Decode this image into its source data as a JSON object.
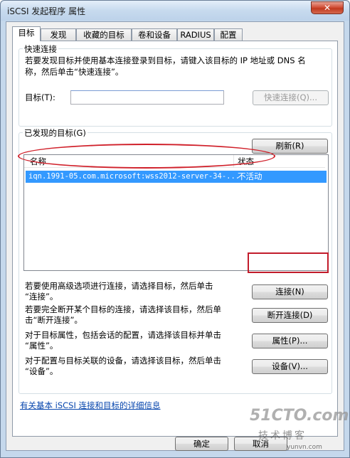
{
  "window": {
    "title": "iSCSI 发起程序 属性",
    "close_glyph": "✕"
  },
  "tabs": [
    {
      "label": "目标",
      "active": true
    },
    {
      "label": "发现"
    },
    {
      "label": "收藏的目标"
    },
    {
      "label": "卷和设备"
    },
    {
      "label": "RADIUS"
    },
    {
      "label": "配置"
    }
  ],
  "quick_connect": {
    "group_title": "快速连接",
    "description_line1": "若要发现目标并使用基本连接登录到目标，请键入该目标的 IP 地址或 DNS 名",
    "description_line2": "称，然后单击“快速连接”。",
    "target_label": "目标(T):",
    "target_value": "",
    "button_label": "快速连接(Q)..."
  },
  "discovered": {
    "group_title": "已发现的目标(G)",
    "refresh_label": "刷新(R)",
    "columns": [
      "名称",
      "状态"
    ],
    "rows": [
      {
        "name": "iqn.1991-05.com.microsoft:wss2012-server-34-...",
        "status": "不活动",
        "selected": true
      }
    ]
  },
  "actions": [
    {
      "line1": "若要使用高级选项进行连接，请选择目标，然后单击",
      "line2": "“连接”。",
      "button": "连接(N)"
    },
    {
      "line1": "若要完全断开某个目标的连接，请选择该目标，然后单",
      "line2": "击“断开连接”。",
      "button": "断开连接(D)"
    },
    {
      "line1": "对于目标属性，包括会话的配置，请选择该目标并单击",
      "line2": "“属性”。",
      "button": "属性(P)..."
    },
    {
      "line1": "对于配置与目标关联的设备，请选择该目标，然后单击",
      "line2": "“设备”。",
      "button": "设备(V)..."
    }
  ],
  "help_link": "有关基本 iSCSI 连接和目标的详细信息",
  "footer": {
    "ok_label": "确定",
    "cancel_label": "取消"
  },
  "watermark": {
    "brand": "51CTO.com",
    "subtitle": "技术博客",
    "url": "yunvn.com"
  },
  "colors": {
    "selection": "#3399ff",
    "annotation_red": "#d0202a",
    "title_bar": "#c7daee"
  }
}
